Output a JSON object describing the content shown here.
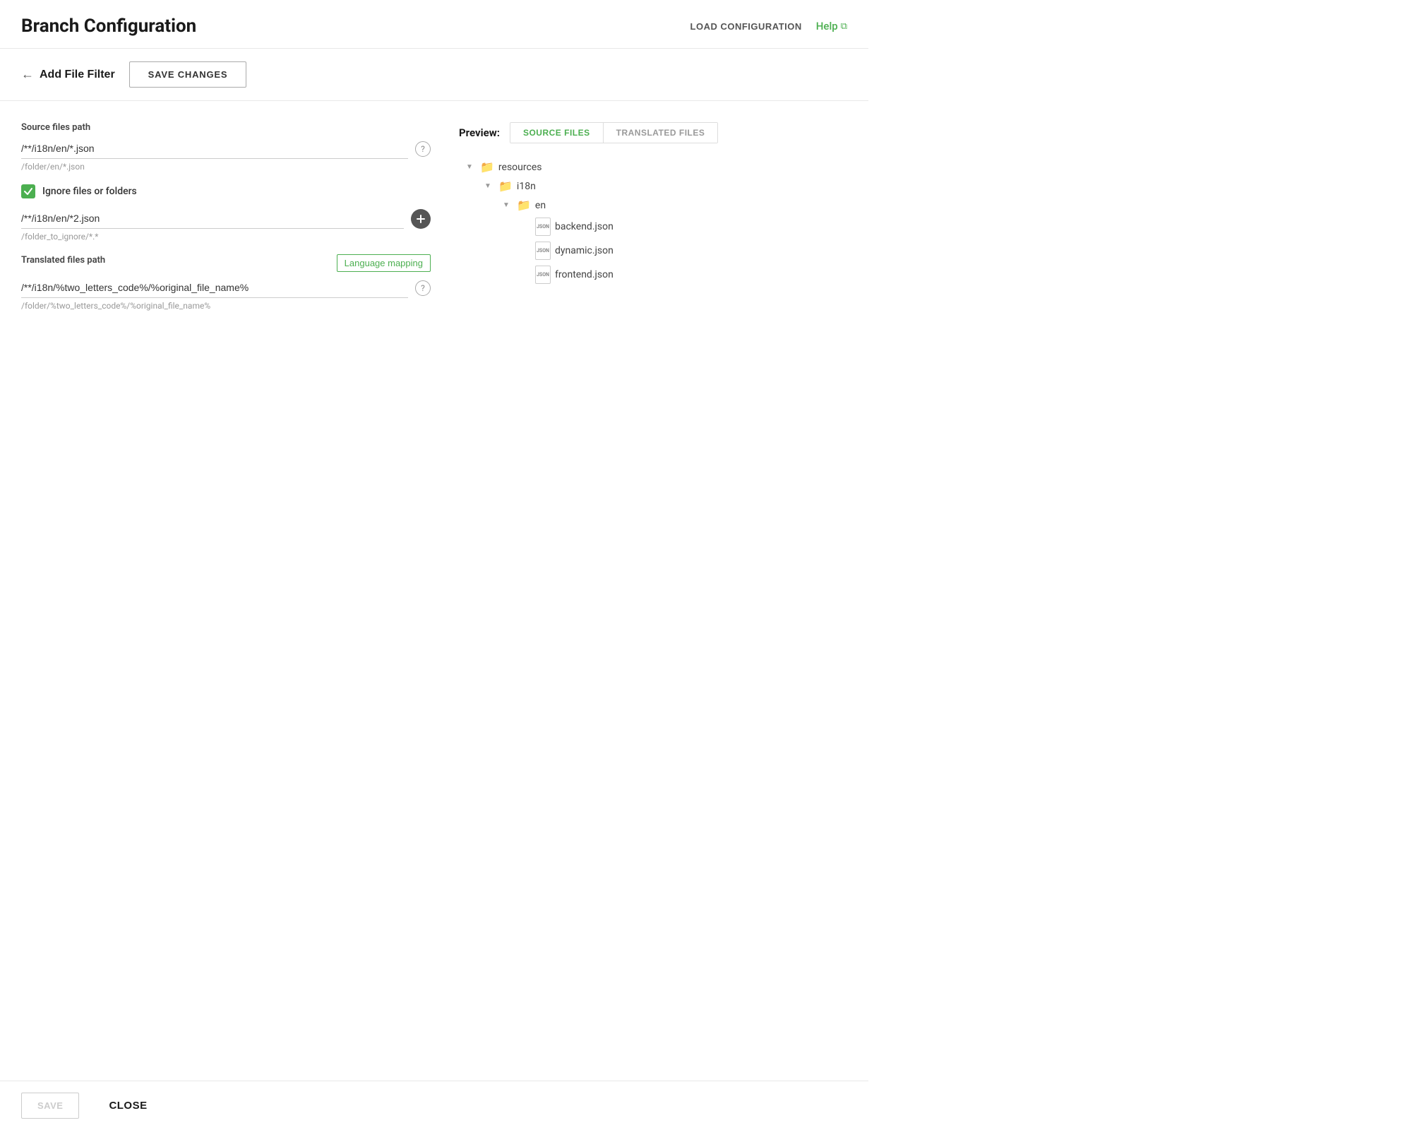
{
  "header": {
    "title": "Branch Configuration",
    "load_config_label": "LOAD CONFIGURATION",
    "help_label": "Help"
  },
  "sub_header": {
    "back_label": "Add File Filter",
    "save_changes_label": "SAVE CHANGES"
  },
  "form": {
    "source_files_label": "Source files path",
    "source_files_value": "/**/i18n/en/*.json",
    "source_files_hint": "/folder/en/*.json",
    "ignore_checkbox_label": "Ignore files or folders",
    "ignore_value": "/**/i18n/en/*2.json",
    "ignore_hint": "/folder_to_ignore/*.*",
    "translated_files_label": "Translated files path",
    "language_mapping_label": "Language mapping",
    "translated_files_value": "/**/i18n/%two_letters_code%/%original_file_name%",
    "translated_files_hint": "/folder/%two_letters_code%/%original_file_name%"
  },
  "preview": {
    "label": "Preview:",
    "tabs": [
      {
        "label": "SOURCE FILES",
        "active": true
      },
      {
        "label": "TRANSLATED FILES",
        "active": false
      }
    ],
    "tree": {
      "name": "resources",
      "children": [
        {
          "name": "i18n",
          "children": [
            {
              "name": "en",
              "children": [
                {
                  "name": "backend.json"
                },
                {
                  "name": "dynamic.json"
                },
                {
                  "name": "frontend.json"
                }
              ]
            }
          ]
        }
      ]
    }
  },
  "bottom": {
    "save_label": "SAVE",
    "close_label": "CLOSE"
  },
  "icons": {
    "back_arrow": "←",
    "external_link": "⧉",
    "question_mark": "?",
    "check": "✓",
    "plus": "+",
    "folder": "▶",
    "folder_open": "▼"
  }
}
